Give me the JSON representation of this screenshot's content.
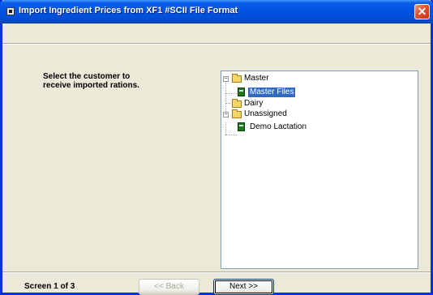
{
  "window": {
    "title": "Import Ingredient Prices from XF1 #SCII File Format",
    "close_glyph": "✕"
  },
  "prompt": "Select the customer to\nreceive imported rations.",
  "tree": {
    "nodes": [
      {
        "label": "Master",
        "expander": "−"
      },
      {
        "label": "Master Files",
        "selected": true
      },
      {
        "label": "Dairy"
      },
      {
        "label": "Unassigned",
        "expander": "−"
      },
      {
        "label": "Demo Lactation"
      }
    ]
  },
  "footer": {
    "screen": "Screen 1 of 3",
    "back_label": "<< Back",
    "next_label": "Next >>"
  },
  "colors": {
    "title_bar": "#0054e3",
    "selection": "#316ac5",
    "dialog_bg": "#ece9d8"
  }
}
